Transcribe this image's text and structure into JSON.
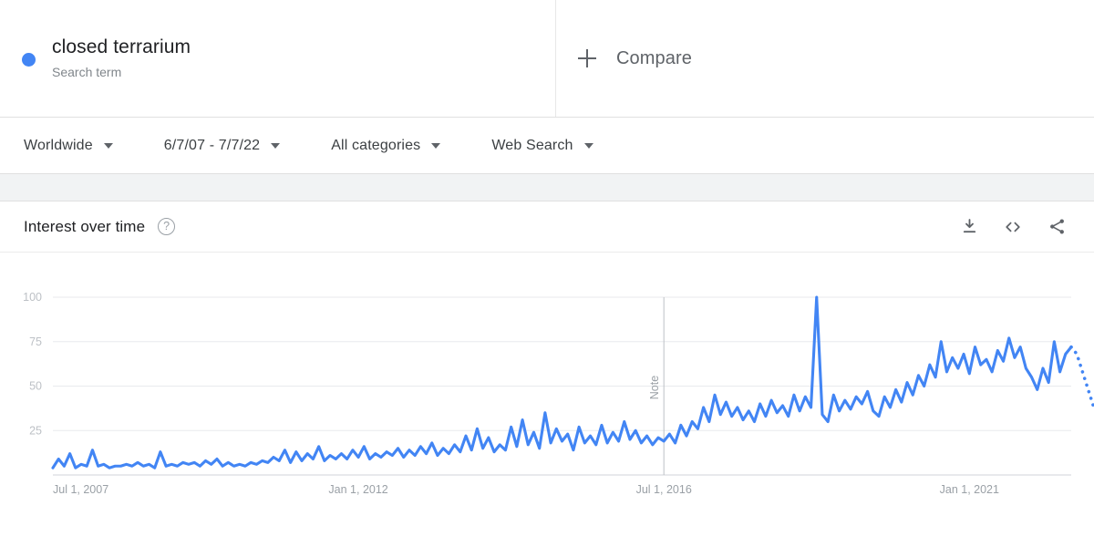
{
  "term": {
    "dot_color": "#4285f4",
    "title": "closed terrarium",
    "subtitle": "Search term"
  },
  "compare": {
    "label": "Compare",
    "icon": "plus-icon"
  },
  "filters": [
    {
      "label": "Worldwide",
      "icon": "chevron-down-icon"
    },
    {
      "label": "6/7/07 - 7/7/22",
      "icon": "chevron-down-icon"
    },
    {
      "label": "All categories",
      "icon": "chevron-down-icon"
    },
    {
      "label": "Web Search",
      "icon": "chevron-down-icon"
    }
  ],
  "chart_header": {
    "title": "Interest over time",
    "help_glyph": "?",
    "actions": [
      {
        "name": "download-icon",
        "tooltip": "Download"
      },
      {
        "name": "embed-icon",
        "tooltip": "Embed"
      },
      {
        "name": "share-icon",
        "tooltip": "Share"
      }
    ]
  },
  "chart_data": {
    "type": "line",
    "title": "Interest over time",
    "xlabel": "",
    "ylabel": "",
    "ylim": [
      0,
      100
    ],
    "yticks": [
      25,
      50,
      75,
      100
    ],
    "grid": true,
    "legend_position": "top",
    "line_color": "#4285f4",
    "series_name": "closed terrarium",
    "xtick_labels": [
      "Jul 1, 2007",
      "Jan 1, 2012",
      "Jul 1, 2016",
      "Jan 1, 2021"
    ],
    "xtick_positions": [
      0,
      54,
      108,
      162
    ],
    "x_start": "Jul 1, 2007",
    "x_end": "Jul 1, 2022",
    "x_unit": "month",
    "n_points": 181,
    "annotations": [
      {
        "label": "Note",
        "x_index": 108,
        "orientation": "vertical"
      }
    ],
    "partial_tail_points": 4,
    "values": [
      4,
      9,
      5,
      12,
      4,
      6,
      5,
      14,
      5,
      6,
      4,
      5,
      5,
      6,
      5,
      7,
      5,
      6,
      4,
      13,
      5,
      6,
      5,
      7,
      6,
      7,
      5,
      8,
      6,
      9,
      5,
      7,
      5,
      6,
      5,
      7,
      6,
      8,
      7,
      10,
      8,
      14,
      7,
      13,
      8,
      12,
      9,
      16,
      8,
      11,
      9,
      12,
      9,
      14,
      10,
      16,
      9,
      12,
      10,
      13,
      11,
      15,
      10,
      14,
      11,
      16,
      12,
      18,
      11,
      15,
      12,
      17,
      13,
      22,
      14,
      26,
      15,
      21,
      13,
      17,
      14,
      27,
      16,
      31,
      17,
      24,
      15,
      35,
      18,
      26,
      19,
      23,
      14,
      27,
      18,
      22,
      17,
      28,
      18,
      24,
      19,
      30,
      20,
      25,
      18,
      22,
      17,
      21,
      19,
      23,
      18,
      28,
      22,
      30,
      26,
      38,
      30,
      45,
      34,
      41,
      33,
      38,
      31,
      36,
      30,
      40,
      33,
      42,
      35,
      39,
      33,
      45,
      36,
      44,
      38,
      100,
      34,
      30,
      45,
      36,
      42,
      37,
      44,
      40,
      47,
      36,
      33,
      44,
      38,
      48,
      41,
      52,
      45,
      56,
      50,
      62,
      55,
      75,
      58,
      66,
      60,
      68,
      57,
      72,
      62,
      65,
      58,
      70,
      64,
      77,
      66,
      72,
      60,
      55,
      48,
      60,
      52,
      75,
      58,
      68,
      72,
      68,
      58,
      48,
      38
    ]
  }
}
